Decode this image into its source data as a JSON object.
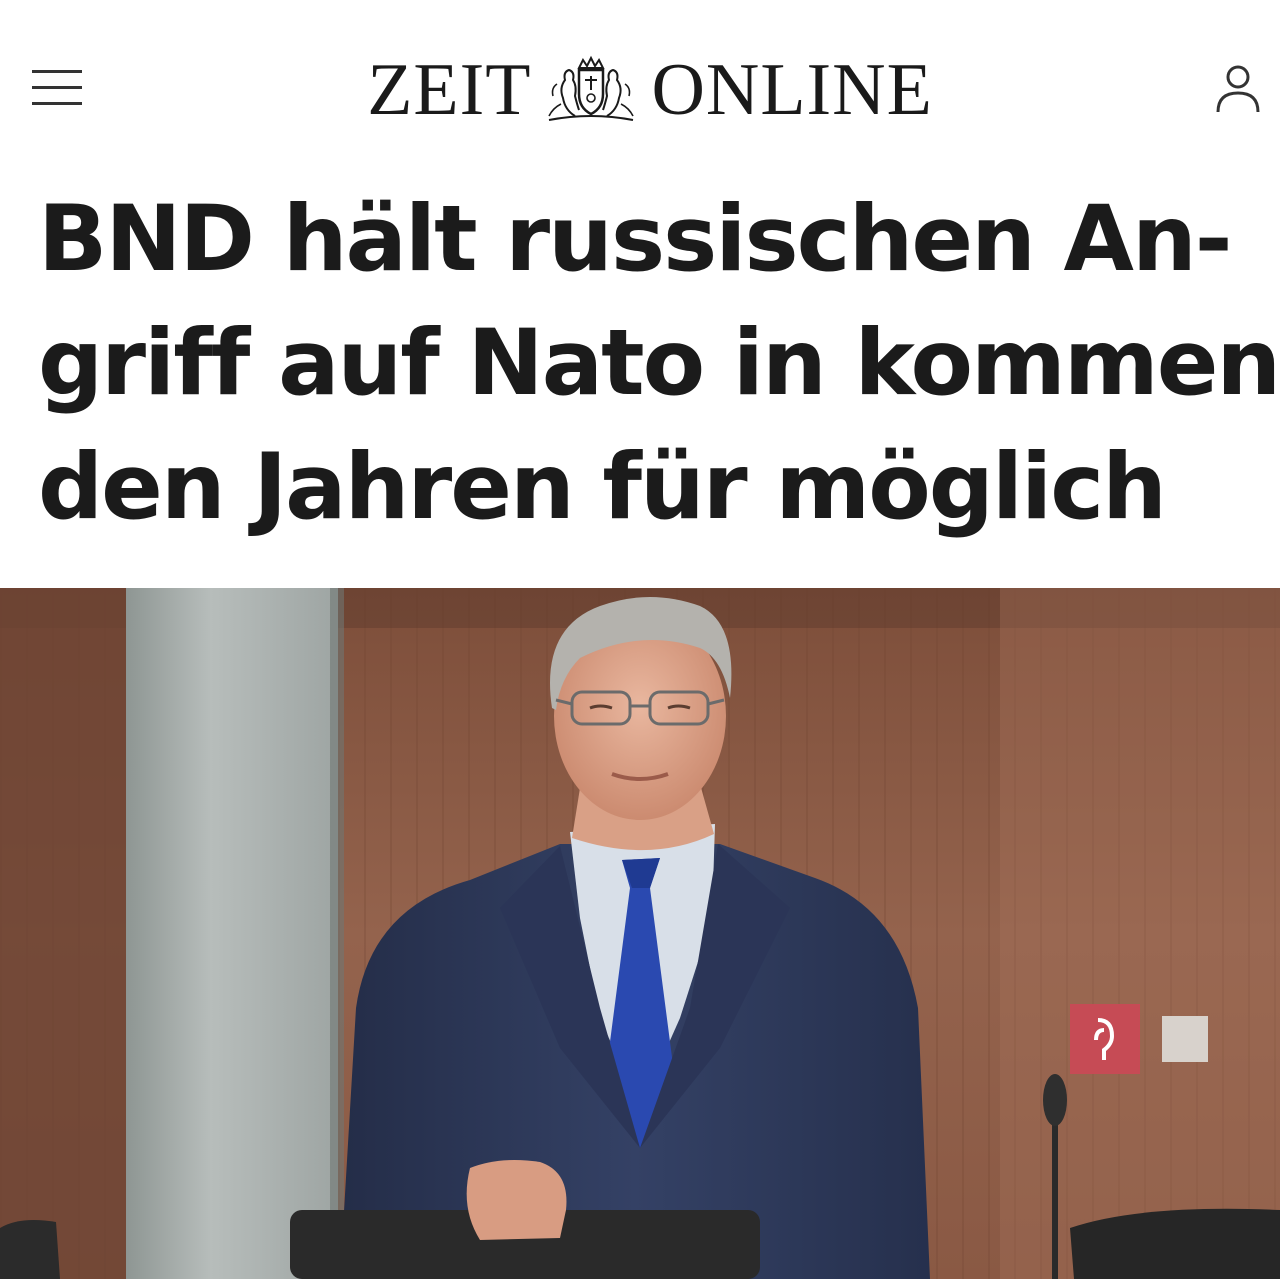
{
  "header": {
    "logo_left": "ZEIT",
    "logo_right": "ONLINE",
    "menu_icon": "hamburger-menu-icon",
    "account_icon": "user-account-icon"
  },
  "article": {
    "headline_lines": [
      "BND hält russischen An-",
      "griff auf Nato in kommen-",
      "den Jahren für möglich"
    ]
  },
  "colors": {
    "headline": "#1b1b1b",
    "background": "#ffffff",
    "wall": "#8a5a44",
    "suit": "#2e3a5c",
    "tie": "#2a49b0"
  }
}
